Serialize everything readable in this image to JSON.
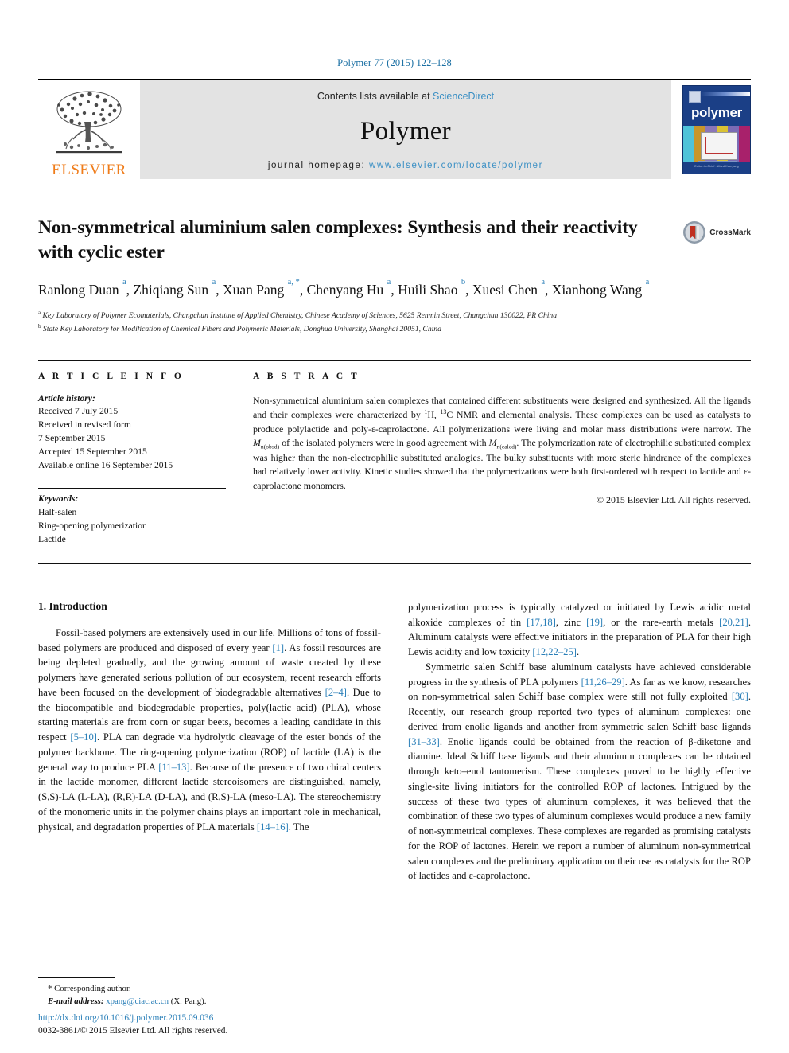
{
  "running_head": "Polymer 77 (2015) 122–128",
  "banner": {
    "publisher": "ELSEVIER",
    "contents_prefix": "Contents lists available at ",
    "contents_link": "ScienceDirect",
    "journal_name": "Polymer",
    "homepage_prefix": "journal homepage: ",
    "homepage_url": "www.elsevier.com/locate/polymer",
    "cover_title": "polymer",
    "cover_footer": "Editor-in-Chief: Alfred Kuo-yang"
  },
  "article": {
    "title": "Non-symmetrical aluminium salen complexes: Synthesis and their reactivity with cyclic ester",
    "crossmark_label": "CrossMark",
    "authors": [
      {
        "name": "Ranlong Duan",
        "marks": "a",
        "sep": ", "
      },
      {
        "name": "Zhiqiang Sun",
        "marks": "a",
        "sep": ", "
      },
      {
        "name": "Xuan Pang",
        "marks": "a, *",
        "sep": ", "
      },
      {
        "name": "Chenyang Hu",
        "marks": "a",
        "sep": ", "
      },
      {
        "name": "Huili Shao",
        "marks": "b",
        "sep": ", "
      },
      {
        "name": "Xuesi Chen",
        "marks": "a",
        "sep": ", "
      },
      {
        "name": "Xianhong Wang",
        "marks": "a",
        "sep": ""
      }
    ],
    "affiliations": [
      {
        "mark": "a",
        "text": "Key Laboratory of Polymer Ecomaterials, Changchun Institute of Applied Chemistry, Chinese Academy of Sciences, 5625 Renmin Street, Changchun 130022, PR China"
      },
      {
        "mark": "b",
        "text": "State Key Laboratory for Modification of Chemical Fibers and Polymeric Materials, Donghua University, Shanghai 20051, China"
      }
    ]
  },
  "article_info": {
    "heading": "A R T I C L E   I N F O",
    "history_label": "Article history:",
    "history": [
      "Received 7 July 2015",
      "Received in revised form",
      "7 September 2015",
      "Accepted 15 September 2015",
      "Available online 16 September 2015"
    ],
    "keywords_label": "Keywords:",
    "keywords": [
      "Half-salen",
      "Ring-opening polymerization",
      "Lactide"
    ]
  },
  "abstract": {
    "heading": "A B S T R A C T",
    "text_part1": "Non-symmetrical aluminium salen complexes that contained different substituents were designed and synthesized. All the ligands and their complexes were characterized by ",
    "sup_1": "1",
    "text_part2": "H, ",
    "sup_13": "13",
    "text_part3": "C NMR and elemental analysis. These complexes can be used as catalysts to produce polylactide and poly-ε-caprolactone. All polymerizations were living and molar mass distributions were narrow. The ",
    "mn_obsd_letter": "M",
    "mn_obsd_sub": "n(obsd)",
    "text_part4": " of the isolated polymers were in good agreement with ",
    "mn_calcd_letter": "M",
    "mn_calcd_sub": "n(calcd)",
    "text_part5": ". The polymerization rate of electrophilic substituted complex was higher than the non-electrophilic substituted analogies. The bulky substituents with more steric hindrance of the complexes had relatively lower activity. Kinetic studies showed that the polymerizations were both first-ordered with respect to lactide and ε-caprolactone monomers.",
    "copyright": "© 2015 Elsevier Ltd. All rights reserved."
  },
  "introduction": {
    "section_title": "1. Introduction",
    "left_paragraph": {
      "seg1": "Fossil-based polymers are extensively used in our life. Millions of tons of fossil-based polymers are produced and disposed of every year ",
      "c1": "[1]",
      "seg2": ". As fossil resources are being depleted gradually, and the growing amount of waste created by these polymers have generated serious pollution of our ecosystem, recent research efforts have been focused on the development of biodegradable alternatives ",
      "c2": "[2–4]",
      "seg3": ". Due to the biocompatible and biodegradable properties, poly(lactic acid) (PLA), whose starting materials are from corn or sugar beets, becomes a leading candidate in this respect ",
      "c3": "[5–10]",
      "seg4": ". PLA can degrade via hydrolytic cleavage of the ester bonds of the polymer backbone. The ring-opening polymerization (ROP) of lactide (LA) is the general way to produce PLA ",
      "c4": "[11–13]",
      "seg5": ". Because of the presence of two chiral centers in the lactide monomer, different lactide stereoisomers are distinguished, namely, (S,S)-LA (L-LA), (R,R)-LA (D-LA), and (R,S)-LA (meso-LA). The stereochemistry of the monomeric units in the polymer chains plays an important role in mechanical, physical, and degradation properties of PLA materials ",
      "c5": "[14–16]",
      "seg6": ". The"
    },
    "right_paragraph_1": {
      "seg1": "polymerization process is typically catalyzed or initiated by Lewis acidic metal alkoxide complexes of tin ",
      "c1": "[17,18]",
      "seg2": ", zinc ",
      "c2": "[19]",
      "seg3": ", or the rare-earth metals ",
      "c3": "[20,21]",
      "seg4": ". Aluminum catalysts were effective initiators in the preparation of PLA for their high Lewis acidity and low toxicity ",
      "c4": "[12,22–25]",
      "seg5": "."
    },
    "right_paragraph_2": {
      "seg1": "Symmetric salen Schiff base aluminum catalysts have achieved considerable progress in the synthesis of PLA polymers ",
      "c1": "[11,26–29]",
      "seg2": ". As far as we know, researches on non-symmetrical salen Schiff base complex were still not fully exploited ",
      "c2": "[30]",
      "seg3": ". Recently, our research group reported two types of aluminum complexes: one derived from enolic ligands and another from symmetric salen Schiff base ligands ",
      "c3": "[31–33]",
      "seg4": ". Enolic ligands could be obtained from the reaction of β-diketone and diamine. Ideal Schiff base ligands and their aluminum complexes can be obtained through keto–enol tautomerism. These complexes proved to be highly effective single-site living initiators for the controlled ROP of lactones. Intrigued by the success of these two types of aluminum complexes, it was believed that the combination of these two types of aluminum complexes would produce a new family of non-symmetrical complexes. These complexes are regarded as promising catalysts for the ROP of lactones. Herein we report a number of aluminum non-symmetrical salen complexes and the preliminary application on their use as catalysts for the ROP of lactides and ε-caprolactone."
    }
  },
  "footnote": {
    "corresponding": "* Corresponding author.",
    "email_label": "E-mail address:",
    "email": "xpang@ciac.ac.cn",
    "email_owner": "(X. Pang)."
  },
  "page_footer": {
    "doi": "http://dx.doi.org/10.1016/j.polymer.2015.09.036",
    "issn_line": "0032-3861/© 2015 Elsevier Ltd. All rights reserved."
  },
  "colors": {
    "link_blue": "#2a7fb8",
    "header_blue": "#1a6fa3",
    "elsevier_orange": "#ef7c1a",
    "banner_gray": "#e3e3e3",
    "cover_blue": "#1b3f86"
  }
}
